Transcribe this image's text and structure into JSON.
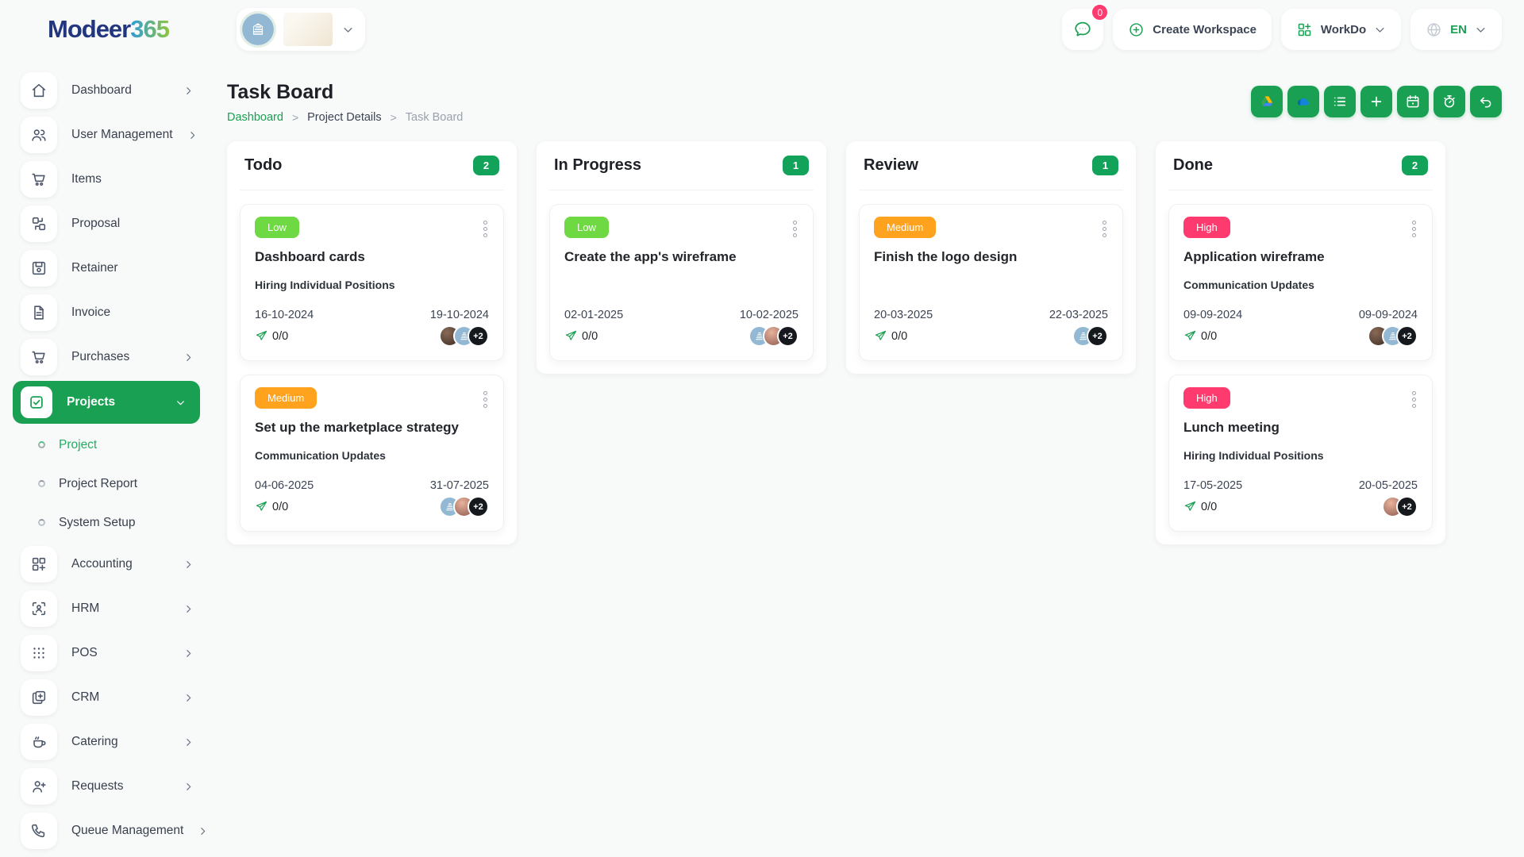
{
  "brand": {
    "name_primary": "Modeer",
    "name_suffix": "365"
  },
  "header": {
    "chat_badge": "0",
    "create_workspace_label": "Create Workspace",
    "workdo_label": "WorkDo",
    "language_label": "EN"
  },
  "page": {
    "title": "Task Board",
    "breadcrumb": [
      {
        "label": "Dashboard"
      },
      {
        "label": "Project Details"
      },
      {
        "label": "Task Board"
      }
    ]
  },
  "toolbar": {
    "buttons": [
      {
        "name": "google-drive"
      },
      {
        "name": "onedrive"
      },
      {
        "name": "task-list"
      },
      {
        "name": "add-task"
      },
      {
        "name": "calendar"
      },
      {
        "name": "timer"
      },
      {
        "name": "undo"
      }
    ]
  },
  "sidebar": {
    "items": [
      {
        "label": "Dashboard",
        "icon": "home",
        "chevron": "right"
      },
      {
        "label": "User Management",
        "icon": "users",
        "chevron": "right"
      },
      {
        "label": "Items",
        "icon": "cart"
      },
      {
        "label": "Proposal",
        "icon": "proposal"
      },
      {
        "label": "Retainer",
        "icon": "retainer"
      },
      {
        "label": "Invoice",
        "icon": "invoice"
      },
      {
        "label": "Purchases",
        "icon": "cart",
        "chevron": "right"
      },
      {
        "label": "Projects",
        "icon": "check",
        "chevron": "down",
        "active": true
      },
      {
        "label": "Project",
        "submenu": true,
        "active": true
      },
      {
        "label": "Project Report",
        "submenu": true
      },
      {
        "label": "System Setup",
        "submenu": true
      },
      {
        "label": "Accounting",
        "icon": "accounting",
        "chevron": "right"
      },
      {
        "label": "HRM",
        "icon": "hrm",
        "chevron": "right"
      },
      {
        "label": "POS",
        "icon": "pos",
        "chevron": "right"
      },
      {
        "label": "CRM",
        "icon": "crm",
        "chevron": "right"
      },
      {
        "label": "Catering",
        "icon": "catering",
        "chevron": "right"
      },
      {
        "label": "Requests",
        "icon": "requests",
        "chevron": "right"
      },
      {
        "label": "Queue Management",
        "icon": "queue",
        "chevron": "right"
      }
    ]
  },
  "board": {
    "columns": [
      {
        "name": "Todo",
        "count": "2",
        "cards": [
          {
            "priority": "Low",
            "title": "Dashboard cards",
            "project": "Hiring Individual Positions",
            "start_date": "16-10-2024",
            "end_date": "19-10-2024",
            "progress": "0/0",
            "avatars": [
              "person-a",
              "building"
            ],
            "extra_assignees": "+2"
          },
          {
            "priority": "Medium",
            "title": "Set up the marketplace strategy",
            "project": "Communication Updates",
            "start_date": "04-06-2025",
            "end_date": "31-07-2025",
            "progress": "0/0",
            "avatars": [
              "building",
              "person-b"
            ],
            "extra_assignees": "+2"
          }
        ]
      },
      {
        "name": "In Progress",
        "count": "1",
        "cards": [
          {
            "priority": "Low",
            "title": "Create the app's wireframe",
            "project": "",
            "start_date": "02-01-2025",
            "end_date": "10-02-2025",
            "progress": "0/0",
            "avatars": [
              "building",
              "person-b"
            ],
            "extra_assignees": "+2"
          }
        ]
      },
      {
        "name": "Review",
        "count": "1",
        "cards": [
          {
            "priority": "Medium",
            "title": "Finish the logo design",
            "project": "",
            "start_date": "20-03-2025",
            "end_date": "22-03-2025",
            "progress": "0/0",
            "avatars": [
              "building"
            ],
            "extra_assignees": "+2"
          }
        ]
      },
      {
        "name": "Done",
        "count": "2",
        "cards": [
          {
            "priority": "High",
            "title": "Application wireframe",
            "project": "Communication Updates",
            "start_date": "09-09-2024",
            "end_date": "09-09-2024",
            "progress": "0/0",
            "avatars": [
              "person-a",
              "building"
            ],
            "extra_assignees": "+2"
          },
          {
            "priority": "High",
            "title": "Lunch meeting",
            "project": "Hiring Individual Positions",
            "start_date": "17-05-2025",
            "end_date": "20-05-2025",
            "progress": "0/0",
            "avatars": [
              "person-b"
            ],
            "extra_assignees": "+2"
          }
        ]
      }
    ]
  },
  "colors": {
    "accent": "#1aa053",
    "priority_low": "#6fd943",
    "priority_medium": "#ffa21d",
    "priority_high": "#ff3a6e",
    "count_badge": "#12a259"
  }
}
